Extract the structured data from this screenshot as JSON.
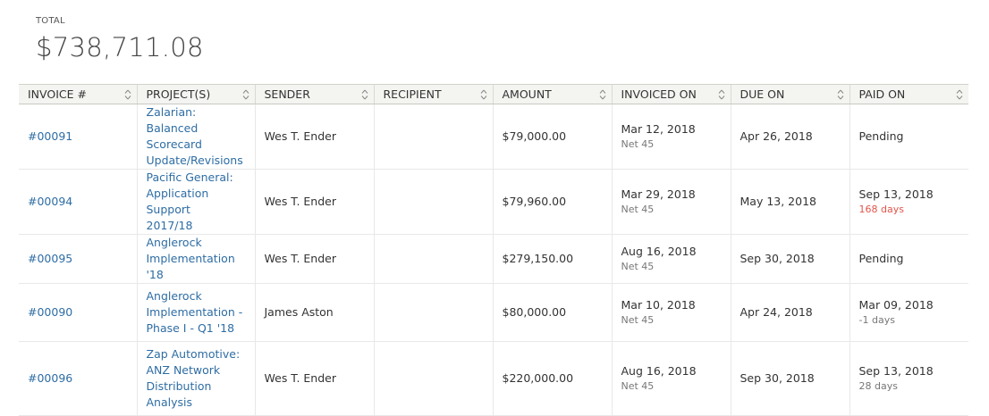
{
  "summary": {
    "label": "TOTAL",
    "value": "$738,711.08"
  },
  "columns": [
    "INVOICE #",
    "PROJECT(S)",
    "SENDER",
    "RECIPIENT",
    "AMOUNT",
    "INVOICED ON",
    "DUE ON",
    "PAID ON"
  ],
  "colors": {
    "link": "#2e6da4",
    "late": "#e0554b",
    "header_bg": "#f4f4f1"
  },
  "icons": {
    "sort": "sort-updown-icon"
  },
  "rows": [
    {
      "invoice": "#00091",
      "project": [
        "Zalarian: Balanced",
        "Scorecard",
        "Update/Revisions"
      ],
      "sender": "Wes T. Ender",
      "recipient": "",
      "amount": "$79,000.00",
      "invoiced_on": "Mar 12, 2018",
      "terms": "Net 45",
      "due_on": "Apr 26, 2018",
      "paid_on": "Pending",
      "paid_note": ""
    },
    {
      "invoice": "#00094",
      "project": [
        "Pacific General:",
        "Application Support",
        "2017/18"
      ],
      "sender": "Wes T. Ender",
      "recipient": "",
      "amount": "$79,960.00",
      "invoiced_on": "Mar 29, 2018",
      "terms": "Net 45",
      "due_on": "May 13, 2018",
      "paid_on": "Sep 13, 2018",
      "paid_note": "168 days",
      "paid_note_late": true
    },
    {
      "invoice": "#00095",
      "project": [
        "Anglerock",
        "Implementation '18"
      ],
      "sender": "Wes T. Ender",
      "recipient": "",
      "amount": "$279,150.00",
      "invoiced_on": "Aug 16, 2018",
      "terms": "Net 45",
      "due_on": "Sep 30, 2018",
      "paid_on": "Pending",
      "paid_note": ""
    },
    {
      "invoice": "#00090",
      "project": [
        "Anglerock",
        "Implementation -",
        "Phase I - Q1 '18"
      ],
      "sender": "James Aston",
      "recipient": "",
      "amount": "$80,000.00",
      "invoiced_on": "Mar 10, 2018",
      "terms": "Net 45",
      "due_on": "Apr 24, 2018",
      "paid_on": "Mar 09, 2018",
      "paid_note": "-1 days"
    },
    {
      "invoice": "#00096",
      "project": [
        "Zap Automotive:",
        "ANZ Network",
        "Distribution",
        "Analysis"
      ],
      "sender": "Wes T. Ender",
      "recipient": "",
      "amount": "$220,000.00",
      "invoiced_on": "Aug 16, 2018",
      "terms": "Net 45",
      "due_on": "Sep 30, 2018",
      "paid_on": "Sep 13, 2018",
      "paid_note": "28 days"
    }
  ]
}
